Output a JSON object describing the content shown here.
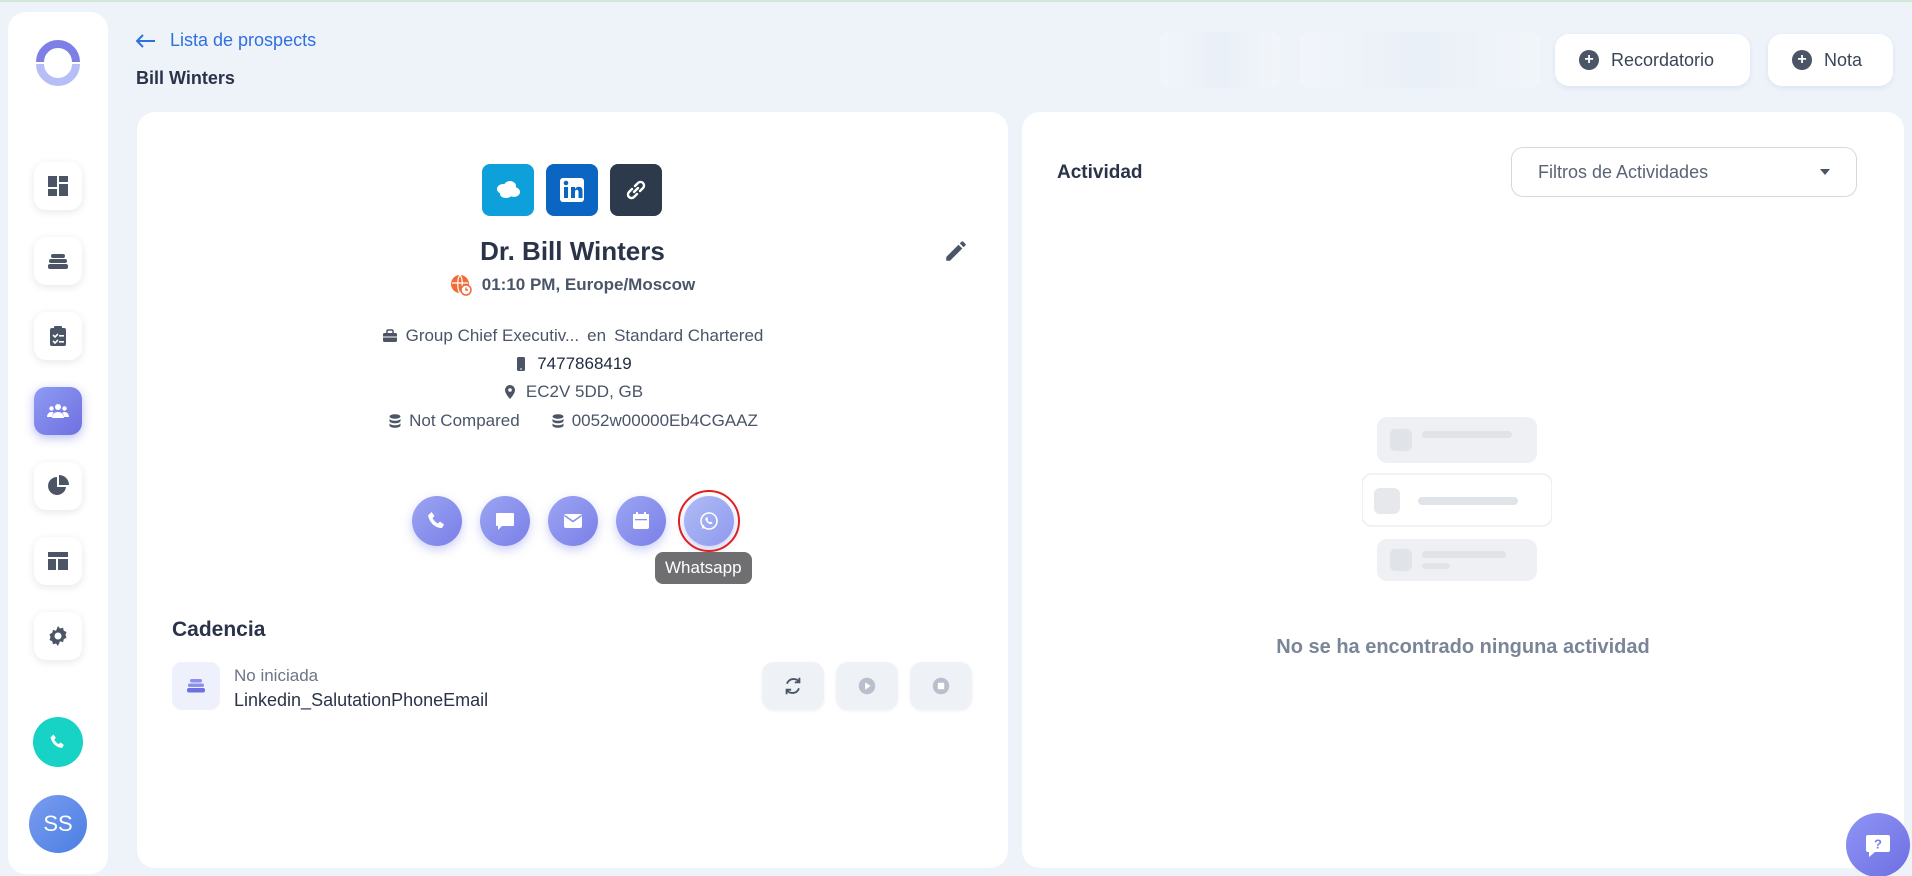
{
  "header": {
    "back_label": "Lista de prospects",
    "page_title": "Bill Winters",
    "reminder_label": "Recordatorio",
    "note_label": "Nota"
  },
  "sidebar": {
    "avatar_initials": "SS",
    "items": [
      {
        "icon": "dashboard-icon"
      },
      {
        "icon": "layers-icon"
      },
      {
        "icon": "clipboard-icon"
      },
      {
        "icon": "people-icon",
        "active": true
      },
      {
        "icon": "pie-chart-icon"
      },
      {
        "icon": "layout-icon"
      },
      {
        "icon": "gear-icon"
      }
    ]
  },
  "prospect": {
    "full_name": "Dr. Bill Winters",
    "local_time": "01:10 PM, Europe/Moscow",
    "job_title": "Group Chief Executiv...",
    "company_connector": "en",
    "company": "Standard Chartered",
    "phone": "7477868419",
    "location": "EC2V 5DD, GB",
    "compare_status": "Not Compared",
    "crm_id": "0052w00000Eb4CGAAZ"
  },
  "actions": {
    "tooltip": "Whatsapp"
  },
  "cadence": {
    "title": "Cadencia",
    "status": "No iniciada",
    "name": "Linkedin_SalutationPhoneEmail"
  },
  "activity": {
    "title": "Actividad",
    "filter_placeholder": "Filtros de Actividades",
    "empty_message": "No se ha encontrado ninguna actividad"
  },
  "colors": {
    "accent": "#7a7fe8",
    "link": "#2f6fe0",
    "salesforce": "#0ea0db",
    "linkedin": "#0a66c2",
    "call_fab": "#17d3c6"
  }
}
